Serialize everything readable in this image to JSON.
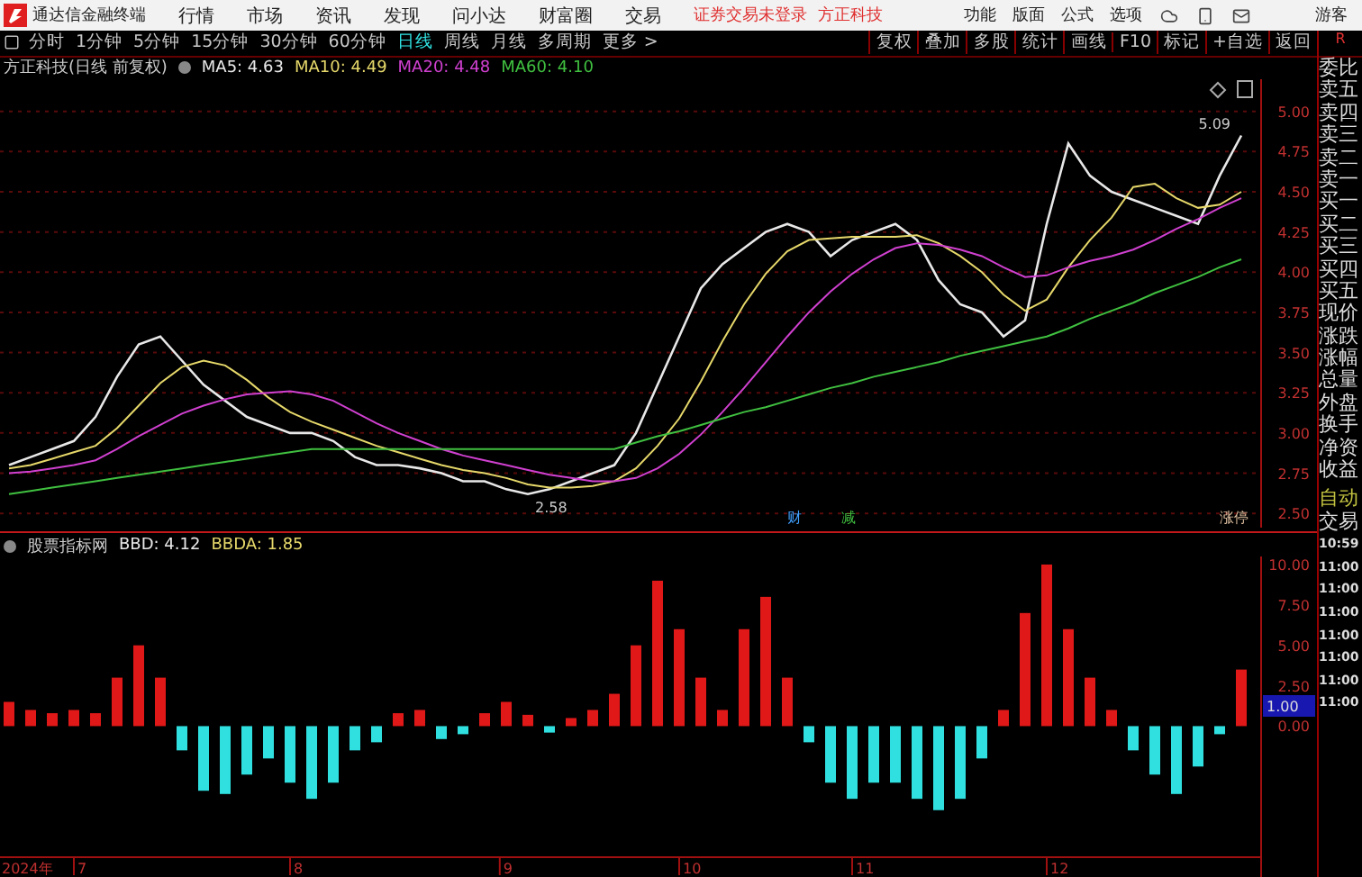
{
  "app": {
    "title": "通达信金融终端"
  },
  "menu": [
    "行情",
    "市场",
    "资讯",
    "发现",
    "问小达",
    "财富圈",
    "交易"
  ],
  "status": {
    "login": "证券交易未登录",
    "stock": "方正科技"
  },
  "right_menu": [
    "功能",
    "版面",
    "公式",
    "选项"
  ],
  "user": "游客",
  "periods": [
    {
      "label": "分时",
      "selected": false
    },
    {
      "label": "1分钟",
      "selected": false
    },
    {
      "label": "5分钟",
      "selected": false
    },
    {
      "label": "15分钟",
      "selected": false
    },
    {
      "label": "30分钟",
      "selected": false
    },
    {
      "label": "60分钟",
      "selected": false
    },
    {
      "label": "日线",
      "selected": true
    },
    {
      "label": "周线",
      "selected": false
    },
    {
      "label": "月线",
      "selected": false
    },
    {
      "label": "多周期",
      "selected": false
    },
    {
      "label": "更多 >",
      "selected": false
    }
  ],
  "tools": [
    "复权",
    "叠加",
    "多股",
    "统计",
    "画线",
    "F10",
    "标记",
    "+自选",
    "返回"
  ],
  "price_pane": {
    "title": "方正科技(日线 前复权)",
    "legend": [
      {
        "label": "MA5: 4.63",
        "color": "#e8e8e8"
      },
      {
        "label": "MA10: 4.49",
        "color": "#e6d86a"
      },
      {
        "label": "MA20: 4.48",
        "color": "#d040d0"
      },
      {
        "label": "MA60: 4.10",
        "color": "#40c040"
      }
    ],
    "tags": [
      {
        "label": "财",
        "color": "#40a0ff"
      },
      {
        "label": "减",
        "color": "#40c040"
      },
      {
        "label": "涨停",
        "color": "#e0c0a0"
      }
    ],
    "high_label": "5.09",
    "low_label": "2.58",
    "chart_data": {
      "type": "line",
      "ylim": [
        2.4,
        5.2
      ],
      "grid": true,
      "yticks": [
        {
          "value": 2.5,
          "label": "2.50"
        },
        {
          "value": 2.75,
          "label": "2.75"
        },
        {
          "value": 3.0,
          "label": "3.00"
        },
        {
          "value": 3.25,
          "label": "3.25"
        },
        {
          "value": 3.5,
          "label": "3.50"
        },
        {
          "value": 3.75,
          "label": "3.75"
        },
        {
          "value": 4.0,
          "label": "4.00"
        },
        {
          "value": 4.25,
          "label": "4.25"
        },
        {
          "value": 4.5,
          "label": "4.50"
        },
        {
          "value": 4.75,
          "label": "4.75"
        },
        {
          "value": 5.0,
          "label": "5.00"
        }
      ],
      "series": [
        {
          "color": "#e8e8e8",
          "values": [
            2.8,
            2.85,
            2.9,
            2.95,
            3.1,
            3.35,
            3.55,
            3.6,
            3.45,
            3.3,
            3.2,
            3.1,
            3.05,
            3.0,
            3.0,
            2.95,
            2.85,
            2.8,
            2.8,
            2.78,
            2.75,
            2.7,
            2.7,
            2.65,
            2.62,
            2.65,
            2.7,
            2.75,
            2.8,
            3.0,
            3.3,
            3.6,
            3.9,
            4.05,
            4.15,
            4.25,
            4.3,
            4.25,
            4.1,
            4.2,
            4.25,
            4.3,
            4.2,
            3.95,
            3.8,
            3.75,
            3.6,
            3.7,
            4.3,
            4.8,
            4.6,
            4.5,
            4.45,
            4.4,
            4.35,
            4.3,
            4.6,
            4.85
          ]
        },
        {
          "color": "#e6d86a",
          "values": [
            2.78,
            2.8,
            2.84,
            2.88,
            2.92,
            3.03,
            3.17,
            3.31,
            3.41,
            3.45,
            3.42,
            3.33,
            3.22,
            3.13,
            3.07,
            3.02,
            2.97,
            2.92,
            2.88,
            2.84,
            2.8,
            2.77,
            2.75,
            2.72,
            2.68,
            2.66,
            2.66,
            2.67,
            2.7,
            2.78,
            2.92,
            3.09,
            3.32,
            3.57,
            3.8,
            3.99,
            4.13,
            4.2,
            4.21,
            4.22,
            4.22,
            4.22,
            4.23,
            4.18,
            4.1,
            4.0,
            3.86,
            3.76,
            3.83,
            4.03,
            4.2,
            4.34,
            4.53,
            4.55,
            4.46,
            4.4,
            4.42,
            4.5
          ]
        },
        {
          "color": "#d040d0",
          "values": [
            2.75,
            2.76,
            2.78,
            2.8,
            2.83,
            2.9,
            2.98,
            3.05,
            3.12,
            3.17,
            3.21,
            3.24,
            3.25,
            3.26,
            3.24,
            3.2,
            3.13,
            3.06,
            3.0,
            2.95,
            2.9,
            2.86,
            2.83,
            2.8,
            2.77,
            2.74,
            2.72,
            2.7,
            2.7,
            2.72,
            2.78,
            2.87,
            2.99,
            3.13,
            3.28,
            3.44,
            3.6,
            3.75,
            3.88,
            3.99,
            4.08,
            4.15,
            4.18,
            4.17,
            4.14,
            4.1,
            4.03,
            3.97,
            3.98,
            4.03,
            4.07,
            4.1,
            4.14,
            4.2,
            4.27,
            4.33,
            4.4,
            4.46
          ]
        },
        {
          "color": "#40c040",
          "values": [
            2.62,
            2.64,
            2.66,
            2.68,
            2.7,
            2.72,
            2.74,
            2.76,
            2.78,
            2.8,
            2.82,
            2.84,
            2.86,
            2.88,
            2.9,
            2.9,
            2.9,
            2.9,
            2.9,
            2.9,
            2.9,
            2.9,
            2.9,
            2.9,
            2.9,
            2.9,
            2.9,
            2.9,
            2.9,
            2.94,
            2.98,
            3.01,
            3.05,
            3.09,
            3.13,
            3.16,
            3.2,
            3.24,
            3.28,
            3.31,
            3.35,
            3.38,
            3.41,
            3.44,
            3.48,
            3.51,
            3.54,
            3.57,
            3.6,
            3.65,
            3.71,
            3.76,
            3.81,
            3.87,
            3.92,
            3.97,
            4.03,
            4.08
          ]
        }
      ]
    }
  },
  "indicator_pane": {
    "title": "股票指标网",
    "legend": [
      {
        "label": "BBD: 4.12",
        "color": "#e8e8e8"
      },
      {
        "label": "BBDA: 1.85",
        "color": "#e6d86a"
      }
    ],
    "cursor_value": "1.00",
    "year_label": "2024年",
    "months": [
      "7",
      "8",
      "9",
      "10",
      "11",
      "12"
    ],
    "chart_data": {
      "type": "bar",
      "ylim": [
        -8,
        10.5
      ],
      "yticks": [
        {
          "value": 0.0,
          "label": "0.00"
        },
        {
          "value": 2.5,
          "label": "2.50"
        },
        {
          "value": 5.0,
          "label": "5.00"
        },
        {
          "value": 7.5,
          "label": "7.50"
        },
        {
          "value": 10.0,
          "label": "10.00"
        }
      ],
      "values": [
        1.5,
        1.0,
        0.8,
        1.0,
        0.8,
        3.0,
        5.0,
        3.0,
        -1.5,
        -4.0,
        -4.2,
        -3.0,
        -2.0,
        -3.5,
        -4.5,
        -3.5,
        -1.5,
        -1,
        0.8,
        1.0,
        -0.8,
        -0.5,
        0.8,
        1.5,
        0.7,
        -0.4,
        0.5,
        1.0,
        2.0,
        5.0,
        9.0,
        6.0,
        3.0,
        1.0,
        6.0,
        8.0,
        3.0,
        -1.0,
        -3.5,
        -4.5,
        -3.5,
        -3.5,
        -4.5,
        -5.2,
        -4.5,
        -2.0,
        1.0,
        7.0,
        10.0,
        6.0,
        3.0,
        1.0,
        -1.5,
        -3.0,
        -4.2,
        -2.5,
        -0.5,
        3.5
      ]
    }
  },
  "quote_panel": {
    "header": "R",
    "labels": [
      "委比",
      "卖五",
      "卖四",
      "卖三",
      "卖二",
      "卖一",
      "买一",
      "买二",
      "买三",
      "买四",
      "买五",
      "现价",
      "涨跌",
      "涨幅",
      "总量",
      "外盘",
      "换手",
      "净资",
      "收益"
    ],
    "trade_labels": [
      "自动",
      "交易"
    ],
    "times": [
      "10:59",
      "11:00",
      "11:00",
      "11:00",
      "11:00",
      "11:00",
      "11:00",
      "11:00"
    ]
  }
}
